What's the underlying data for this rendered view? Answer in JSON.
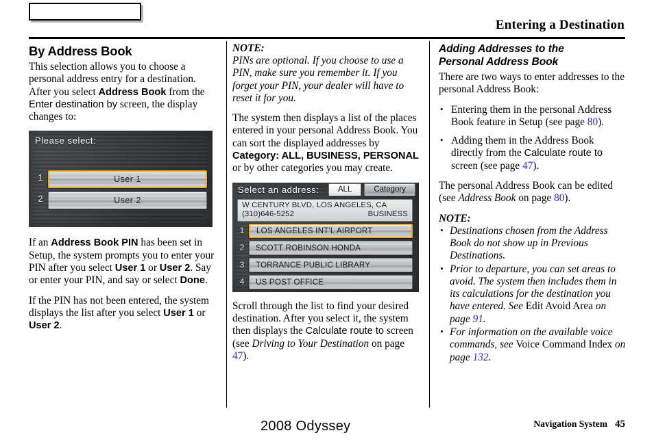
{
  "header": {
    "tab_label": "",
    "chapter_title": "Entering a Destination"
  },
  "col1": {
    "section_title": "By Address Book",
    "p1_a": "This selection allows you to choose a personal address entry for a destination. After you select ",
    "p1_b": "Address Book",
    "p1_c": " from the ",
    "p1_d": "Enter destination by",
    "p1_e": " screen, the display changes to:",
    "screen1": {
      "title": "Please select:",
      "rows": [
        {
          "num": "1",
          "label": "User 1",
          "selected": true
        },
        {
          "num": "2",
          "label": "User 2",
          "selected": false
        }
      ]
    },
    "p2_a": "If an ",
    "p2_b": "Address Book PIN",
    "p2_c": " has been set in Setup, the system prompts you to enter your PIN after you select ",
    "p2_d": "User 1",
    "p2_e": " or ",
    "p2_f": "User 2",
    "p2_g": ". Say or enter your PIN, and say or select ",
    "p2_h": "Done",
    "p2_i": ".",
    "p3_a": "If the PIN has not been entered, the system displays the list after you select ",
    "p3_b": "User 1",
    "p3_c": " or ",
    "p3_d": "User 2",
    "p3_e": "."
  },
  "col2": {
    "note_heading": "NOTE:",
    "note_body": "PINs are optional. If you choose to use a PIN, make sure you remember it. If you forget your PIN, your dealer will have to reset it for you.",
    "p1_a": "The system then displays a list of the places entered in your personal Address Book. You can sort the displayed addresses by ",
    "p1_b": "Category: ALL, BUSINESS, PERSONAL",
    "p1_c": " or by other categories you may create.",
    "screen2": {
      "title": "Select an address:",
      "filter_all": "ALL",
      "filter_category": "Category",
      "info_address": "W CENTURY BLVD, LOS ANGELES, CA",
      "info_phone": "(310)646-5252",
      "info_category": "BUSINESS",
      "rows": [
        {
          "num": "1",
          "label": "LOS ANGELES INT'L AIRPORT",
          "selected": true
        },
        {
          "num": "2",
          "label": "SCOTT ROBINSON HONDA",
          "selected": false
        },
        {
          "num": "3",
          "label": "TORRANCE PUBLIC LIBRARY",
          "selected": false
        },
        {
          "num": "4",
          "label": "US POST OFFICE",
          "selected": false
        }
      ]
    },
    "p2_a": "Scroll through the list to find your desired destination. After you select it, the system then displays the ",
    "p2_b": "Calculate route to",
    "p2_c": " screen (see ",
    "p2_d": "Driving to Your Destination",
    "p2_e": " on page ",
    "p2_f": "47",
    "p2_g": ")."
  },
  "col3": {
    "section_title_l1": "Adding Addresses to the",
    "section_title_l2": "Personal Address Book",
    "p1": "There are two ways to enter addresses to the personal Address Book:",
    "bullet1_a": "Entering them in the personal Address Book feature in Setup (see page ",
    "bullet1_b": "80",
    "bullet1_c": ").",
    "bullet2_a": "Adding them in the Address Book directly from the ",
    "bullet2_b": "Calculate route to",
    "bullet2_c": " screen (see page ",
    "bullet2_d": "47",
    "bullet2_e": ").",
    "p2_a": "The personal Address Book can be edited (see ",
    "p2_b": "Address Book",
    "p2_c": " on page ",
    "p2_d": "80",
    "p2_e": ").",
    "note_heading": "NOTE:",
    "note_b1": "Destinations chosen from the Address Book do not show up in Previous Destinations.",
    "note_b2_a": "Prior to departure, you can set areas to avoid. The system then includes them in its calculations for the destination you have entered. See ",
    "note_b2_b": "Edit Avoid Area",
    "note_b2_c": " on page ",
    "note_b2_d": "91",
    "note_b2_e": ".",
    "note_b3_a": "For information on the available voice commands, see ",
    "note_b3_b": "Voice Command Index",
    "note_b3_c": " on page ",
    "note_b3_d": "132",
    "note_b3_e": "."
  },
  "footer": {
    "model": "2008  Odyssey",
    "system": "Navigation System",
    "page": "45"
  },
  "colors": {
    "page_link": "#2b2bbd",
    "nav_selection": "#f0a81e",
    "nav_background": "#3b3f41"
  }
}
